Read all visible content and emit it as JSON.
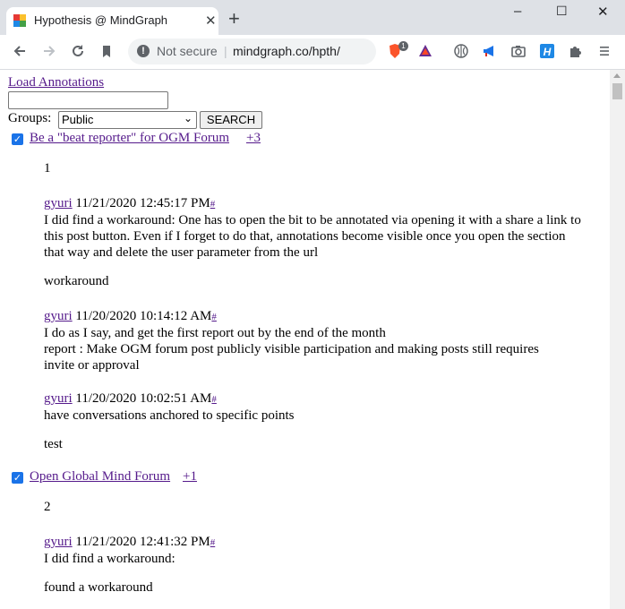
{
  "browser": {
    "tab_title": "Hypothesis @ MindGraph",
    "close_tab": "✕",
    "new_tab": "+",
    "security_label": "Not secure",
    "url": "mindgraph.co/hpth/",
    "brave_badge": "1",
    "window_controls": {
      "minimize": "–",
      "maximize": "☐",
      "close": "✕"
    }
  },
  "page": {
    "load_annotations": "Load Annotations",
    "search_value": "",
    "groups_label": "Groups:",
    "groups_selected": "Public",
    "search_button": "SEARCH",
    "topics": [
      {
        "title": "Be a \"beat reporter\" for OGM Forum",
        "count": "+3",
        "number": "1",
        "annotations": [
          {
            "user": "gyuri",
            "timestamp": "11/21/2020 12:45:17 PM",
            "hash": "#",
            "text": "I did find a workaround: One has to open the bit to be annotated via opening it with a share a link to this post button. Even if I forget to do that, annotations become visible once you open the section that way and delete the user parameter from the url",
            "tag": "workaround"
          },
          {
            "user": "gyuri",
            "timestamp": "11/20/2020 10:14:12 AM",
            "hash": "#",
            "text_line1": "I do as I say, and get the first report out by the end of the month",
            "text_line2": "report : Make OGM forum post publicly visible participation and making posts still requires invite or approval"
          },
          {
            "user": "gyuri",
            "timestamp": "11/20/2020 10:02:51 AM",
            "hash": "#",
            "text": "have conversations anchored to specific points",
            "tag": "test"
          }
        ]
      },
      {
        "title": "Open Global Mind Forum",
        "count": "+1",
        "number": "2",
        "annotations": [
          {
            "user": "gyuri",
            "timestamp": "11/21/2020 12:41:32 PM",
            "hash": "#",
            "text": "I did find a workaround:",
            "tag": "found a workaround"
          }
        ]
      }
    ]
  },
  "colors": {
    "link": "#551a8b",
    "checkbox": "#1a73e8",
    "chrome_bg": "#dee1e6"
  }
}
